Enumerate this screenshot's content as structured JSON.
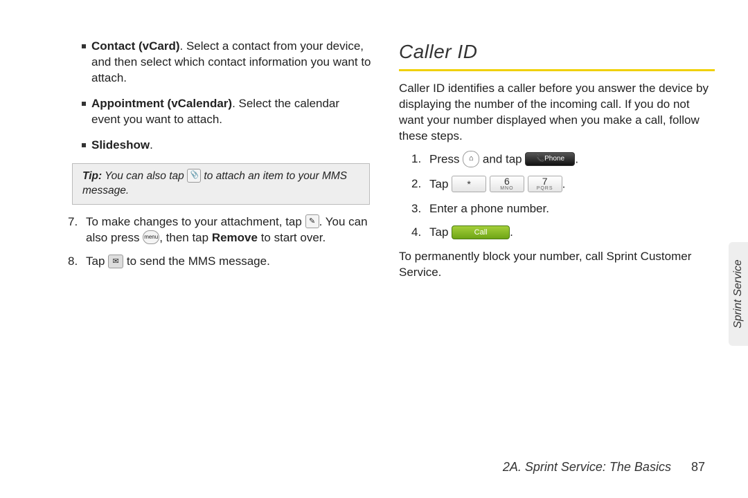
{
  "left": {
    "items": [
      {
        "bold": "Contact (vCard)",
        "rest": ". Select a contact from your device, and then select which contact information you want to attach."
      },
      {
        "bold": "Appointment (vCalendar)",
        "rest": ". Select the calendar event you want to attach."
      },
      {
        "bold": "Slideshow",
        "rest": "."
      }
    ],
    "tip_label": "Tip:",
    "tip_before": " You can also tap ",
    "tip_after": " to attach an item to your MMS message.",
    "step7a": "To make changes to your attachment, tap ",
    "step7b": ". You can also press ",
    "step7c": ", then tap ",
    "step7_remove": "Remove",
    "step7d": " to start over.",
    "step8a": "Tap ",
    "step8b": " to send the MMS message."
  },
  "right": {
    "heading": "Caller ID",
    "intro": "Caller ID identifies a caller before you answer the device by displaying the number of the incoming call. If you do not want your number displayed when you make a call, follow these steps.",
    "s1a": "Press ",
    "s1b": " and tap ",
    "phone_label": "Phone",
    "s2": "Tap ",
    "key_star": "*",
    "key6": "6",
    "key6sub": "MNO",
    "key7": "7",
    "key7sub": "PQRS",
    "s3": "Enter a phone number.",
    "s4": "Tap ",
    "call_label": "Call",
    "outro": "To permanently block your number, call Sprint Customer Service."
  },
  "sidetab": "Sprint Service",
  "footer_section": "2A. Sprint Service: The Basics",
  "footer_page": "87"
}
